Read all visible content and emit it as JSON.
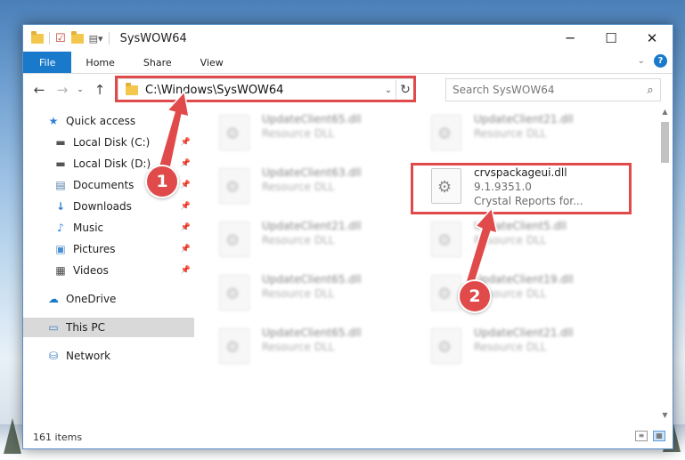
{
  "window": {
    "title": "SysWOW64"
  },
  "titlebar": {
    "minimize": "─",
    "maximize": "☐",
    "close": "✕"
  },
  "ribbon": {
    "tabs": [
      "File",
      "Home",
      "Share",
      "View"
    ],
    "help": "?"
  },
  "address_bar": {
    "path": "C:\\Windows\\SysWOW64",
    "dropdown": "⌄",
    "refresh": "↻"
  },
  "search": {
    "placeholder": "Search SysWOW64"
  },
  "nav_pane": {
    "quick_access": "Quick access",
    "items": [
      {
        "label": "Local Disk (C:)",
        "icon": "drive-icon"
      },
      {
        "label": "Local Disk (D:)",
        "icon": "drive-icon"
      },
      {
        "label": "Documents",
        "icon": "documents-icon"
      },
      {
        "label": "Downloads",
        "icon": "downloads-icon"
      },
      {
        "label": "Music",
        "icon": "music-icon"
      },
      {
        "label": "Pictures",
        "icon": "pictures-icon"
      },
      {
        "label": "Videos",
        "icon": "videos-icon"
      }
    ],
    "onedrive": "OneDrive",
    "this_pc": "This PC",
    "network": "Network"
  },
  "files": [
    {
      "name": "UpdateClient65.dll",
      "type": "Resource DLL"
    },
    {
      "name": "UpdateClient21.dll",
      "type": "Resource DLL"
    },
    {
      "name": "UpdateClient63.dll",
      "type": "Resource DLL"
    },
    {
      "name": "crvspackageui.dll",
      "version": "9.1.9351.0",
      "desc": "Crystal Reports for..."
    },
    {
      "name": "UpdateClient21.dll",
      "type": "Resource DLL"
    },
    {
      "name": "UpdateClient5.dll",
      "type": "Resource DLL"
    },
    {
      "name": "UpdateClient65.dll",
      "type": "Resource DLL"
    },
    {
      "name": "UpdateClient19.dll",
      "type": "Resource DLL"
    },
    {
      "name": "UpdateClient65.dll",
      "type": "Resource DLL"
    },
    {
      "name": "UpdateClient21.dll",
      "type": "Resource DLL"
    }
  ],
  "status": {
    "count": "161 items"
  },
  "annotations": {
    "step1": "1",
    "step2": "2",
    "color": "#e04a4a"
  }
}
